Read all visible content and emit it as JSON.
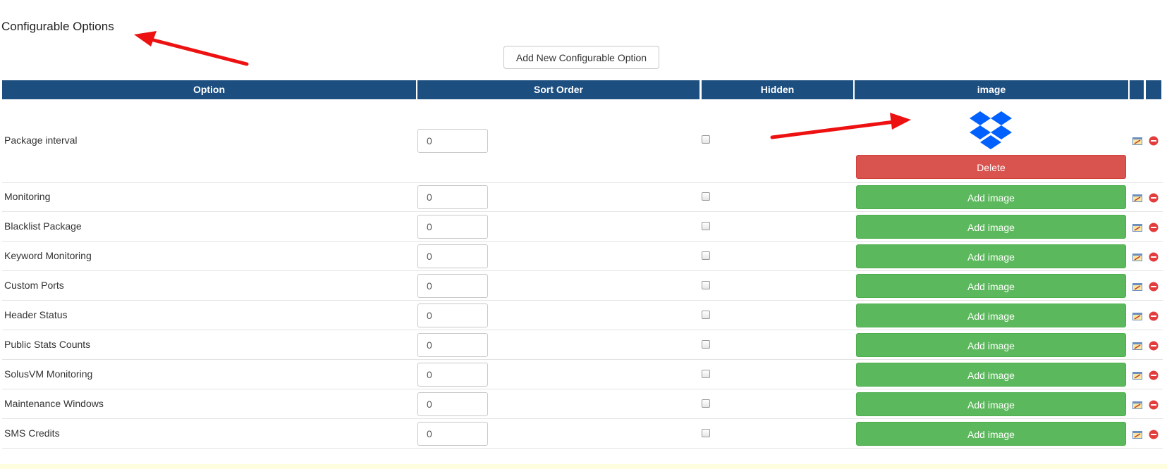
{
  "section": {
    "title": "Configurable Options",
    "add_button_label": "Add New Configurable Option"
  },
  "table": {
    "headers": {
      "option": "Option",
      "sort_order": "Sort Order",
      "hidden": "Hidden",
      "image": "image"
    },
    "rows": [
      {
        "label": "Package interval",
        "sort_order": "0",
        "hidden": false,
        "image_action": "Delete",
        "has_image": true
      },
      {
        "label": "Monitoring",
        "sort_order": "0",
        "hidden": false,
        "image_action": "Add image",
        "has_image": false
      },
      {
        "label": "Blacklist Package",
        "sort_order": "0",
        "hidden": false,
        "image_action": "Add image",
        "has_image": false
      },
      {
        "label": "Keyword Monitoring",
        "sort_order": "0",
        "hidden": false,
        "image_action": "Add image",
        "has_image": false
      },
      {
        "label": "Custom Ports",
        "sort_order": "0",
        "hidden": false,
        "image_action": "Add image",
        "has_image": false
      },
      {
        "label": "Header Status",
        "sort_order": "0",
        "hidden": false,
        "image_action": "Add image",
        "has_image": false
      },
      {
        "label": "Public Stats Counts",
        "sort_order": "0",
        "hidden": false,
        "image_action": "Add image",
        "has_image": false
      },
      {
        "label": "SolusVM Monitoring",
        "sort_order": "0",
        "hidden": false,
        "image_action": "Add image",
        "has_image": false
      },
      {
        "label": "Maintenance Windows",
        "sort_order": "0",
        "hidden": false,
        "image_action": "Add image",
        "has_image": false
      },
      {
        "label": "SMS Credits",
        "sort_order": "0",
        "hidden": false,
        "image_action": "Add image",
        "has_image": false
      }
    ]
  },
  "icons": {
    "image_preview": "dropbox-icon",
    "edit": "edit-icon",
    "delete": "remove-icon",
    "annotation": "red-arrow"
  },
  "colors": {
    "header_bg": "#1c4e80",
    "add_image_btn": "#5cb85c",
    "delete_btn": "#d9534f",
    "dropbox_blue": "#0061fe",
    "annotation_arrow": "#ee1111"
  }
}
